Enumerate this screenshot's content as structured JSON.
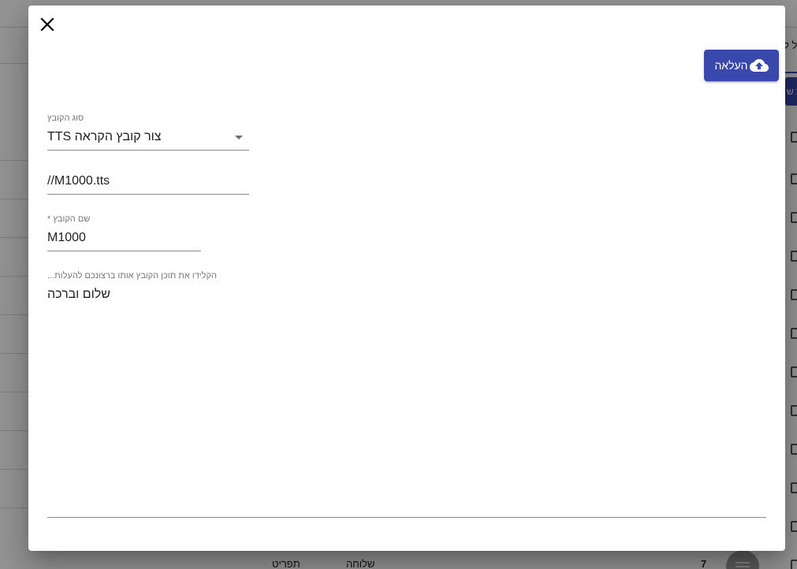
{
  "background": {
    "tab_partial": "של ל",
    "button_partial": "ת ש",
    "footer_col_1": "תפריט",
    "footer_col_2": "שלוחה",
    "footer_col_3": "7"
  },
  "dialog": {
    "upload_button_label": "העלאה",
    "file_type": {
      "label": "סוג הקובץ",
      "value": "צור קובץ הקראה TTS"
    },
    "file_path": {
      "value": "//M1000.tts"
    },
    "file_name": {
      "label": "שם הקובץ *",
      "value": "M1000"
    },
    "content": {
      "placeholder": "הקלידו את תוכן הקובץ אותו ברצונכם להעלות...",
      "value": "שלום וברכה"
    }
  },
  "colors": {
    "accent": "#3949ab",
    "overlay": "rgba(0,0,0,0.42)"
  }
}
